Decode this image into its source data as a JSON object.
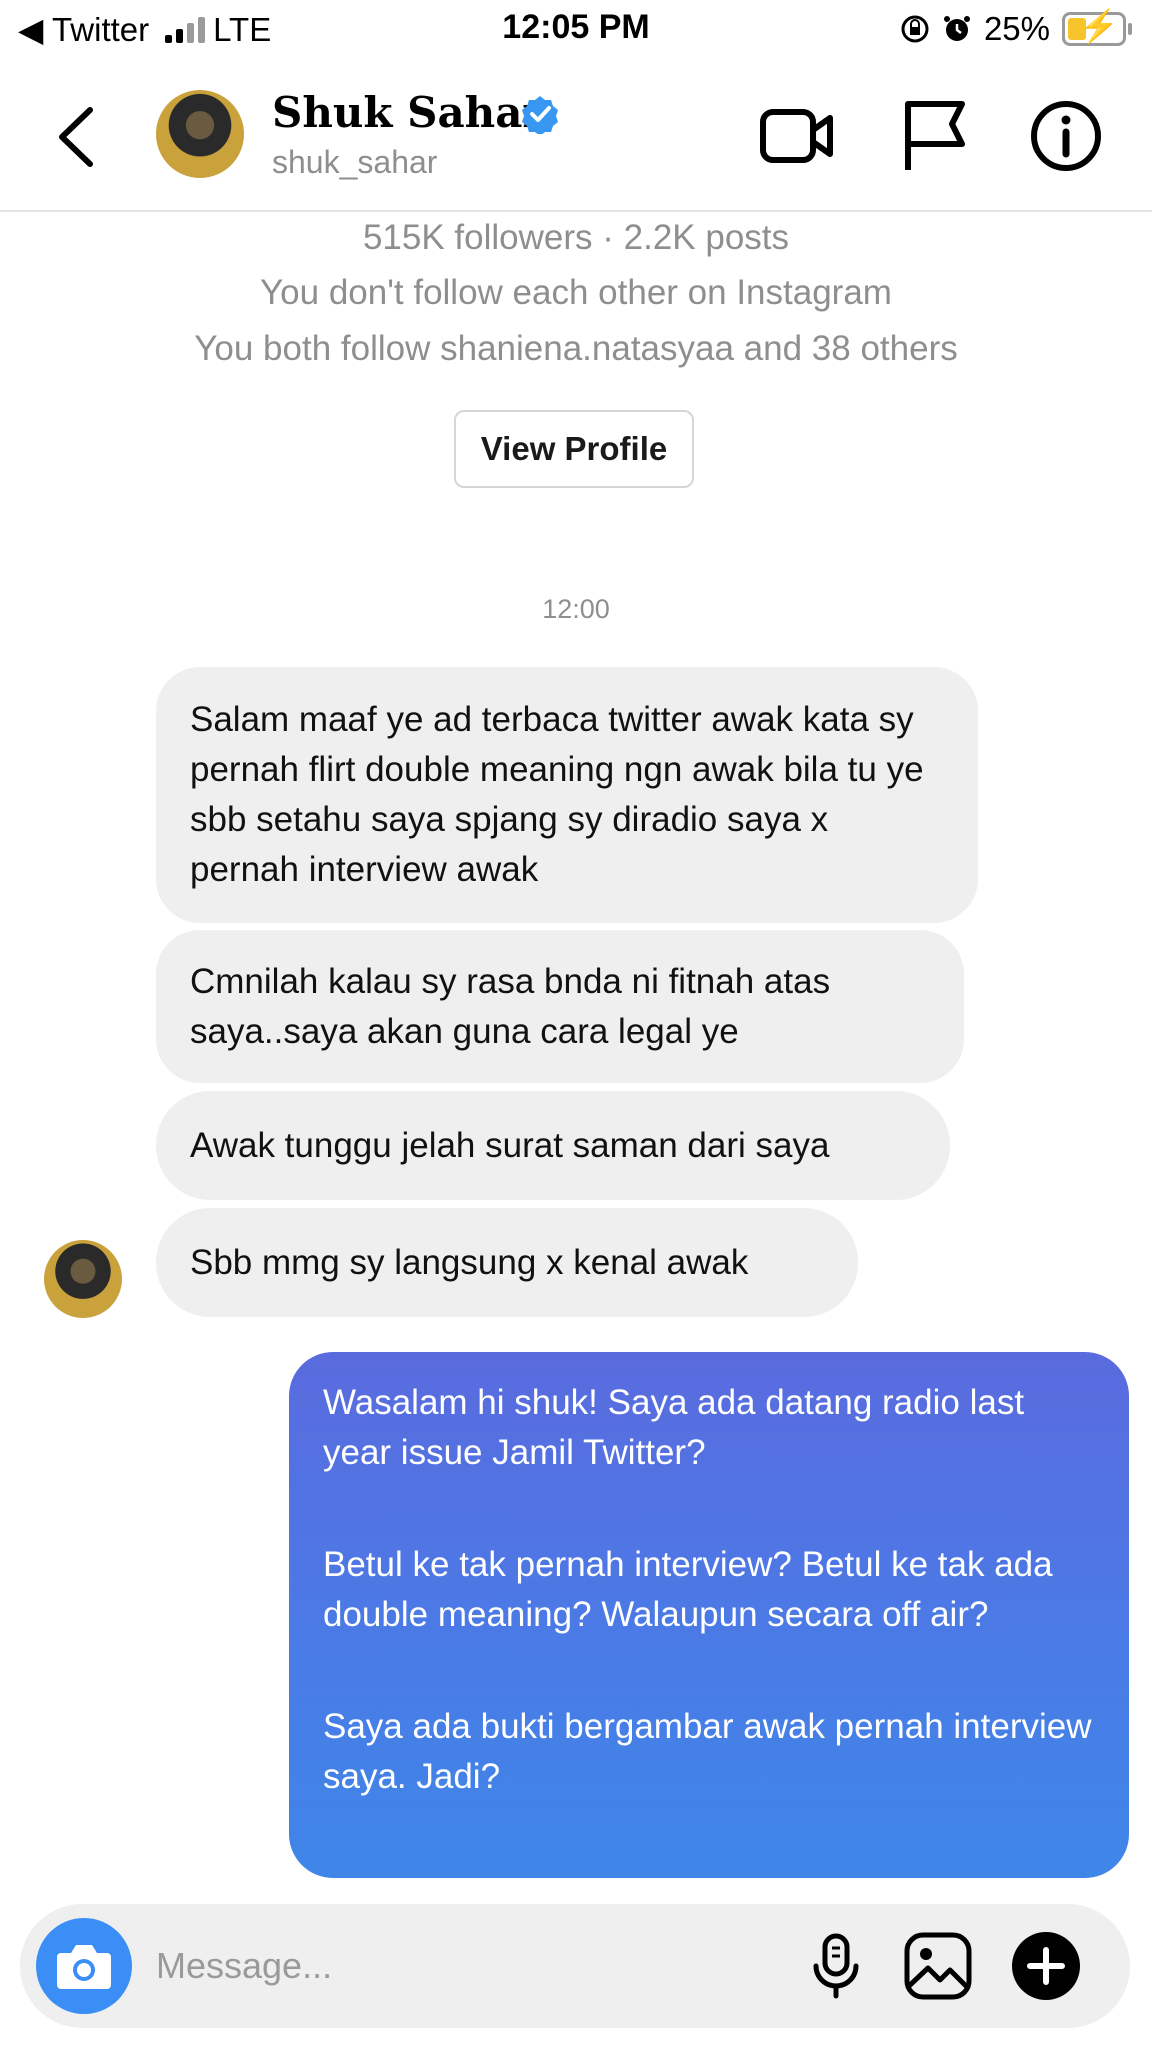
{
  "status_bar": {
    "back_app": "◀ Twitter",
    "network": "LTE",
    "time": "12:05 PM",
    "battery": "25%"
  },
  "header": {
    "name": "Shuk Sahar",
    "username": "shuk_sahar",
    "verified": true
  },
  "profile_info": {
    "stats": "515K followers · 2.2K posts",
    "follow_status": "You don't follow each other on Instagram",
    "mutuals": "You both follow shaniena.natasyaa and 38 others",
    "view_profile_label": "View Profile"
  },
  "thread": {
    "timestamp": "12:00",
    "incoming": [
      "Salam maaf ye ad terbaca twitter awak kata sy pernah flirt double meaning ngn awak bila tu ye sbb setahu saya spjang sy diradio saya x pernah interview awak",
      "Cmnilah kalau sy rasa bnda ni fitnah atas saya..saya akan guna cara legal ye",
      "Awak tunggu jelah surat saman dari saya",
      "Sbb mmg sy langsung x kenal awak"
    ],
    "outgoing": {
      "paragraphs": [
        "Wasalam hi shuk! Saya ada datang radio last year issue Jamil Twitter?",
        "Betul ke tak pernah interview? Betul ke tak ada double meaning? Walaupun secara off air?",
        "Saya ada bukti bergambar awak pernah interview saya. Jadi?"
      ]
    }
  },
  "composer": {
    "placeholder": "Message...",
    "value": ""
  },
  "colors": {
    "outgoing_gradient_top": "#5a6bde",
    "outgoing_gradient_bottom": "#3f86e8",
    "camera_button": "#3a8ef6",
    "incoming_bubble": "#efefef",
    "verified_badge": "#3897f0"
  },
  "icons": [
    "back-chevron-icon",
    "verified-badge-icon",
    "video-call-icon",
    "report-flag-icon",
    "info-icon",
    "camera-icon",
    "microphone-icon",
    "gallery-icon",
    "plus-icon"
  ]
}
